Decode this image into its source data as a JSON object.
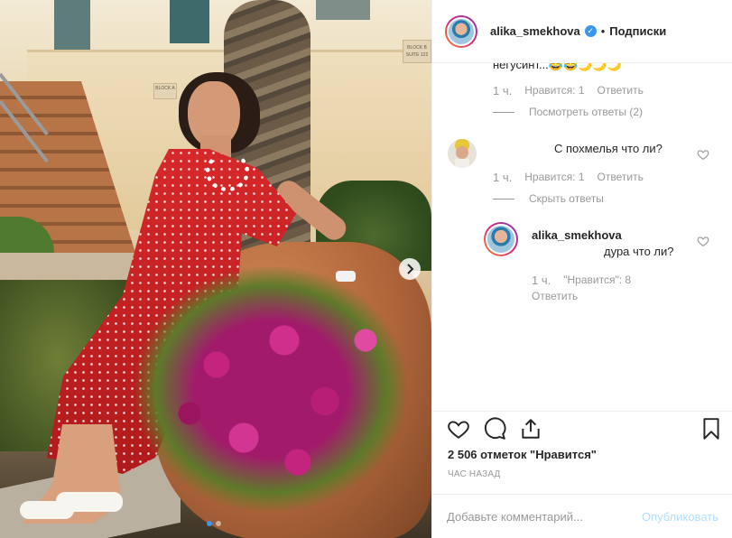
{
  "post": {
    "username": "alika_smekhova",
    "verified_mark": "✓",
    "separator": "•",
    "follow_label": "Подписки",
    "sign_text": "BLOCK B SUITE 122",
    "sign2_text": "BLOCK A"
  },
  "carousel": {
    "slide_count": 2,
    "active_slide": 1
  },
  "comments": {
    "truncated_text": "негусинт...😂😂🌙🌙🌙",
    "first_meta": {
      "time": "1 ч.",
      "likes": "Нравится: 1",
      "reply": "Ответить"
    },
    "view_replies": "Посмотреть ответы (2)",
    "second": {
      "text": "С похмелья что ли?",
      "time": "1 ч.",
      "likes": "Нравится: 1",
      "reply": "Ответить",
      "hide_replies": "Скрыть ответы"
    },
    "reply": {
      "username": "alika_smekhova",
      "text": "дура что ли?",
      "time": "1 ч.",
      "likes": "\"Нравится\": 8",
      "reply": "Ответить"
    }
  },
  "likes_text": "2 506 отметок \"Нравится\"",
  "time_ago": "ЧАС НАЗАД",
  "add_comment": {
    "placeholder": "Добавьте комментарий...",
    "publish_label": "Опубликовать"
  },
  "colors": {
    "accent": "#3897f0",
    "publish_disabled": "#b2dffc",
    "muted": "#999999",
    "text": "#262626"
  },
  "icons": [
    "chevron-right-icon",
    "heart-icon",
    "comment-icon",
    "share-icon",
    "bookmark-icon",
    "verified-icon"
  ]
}
